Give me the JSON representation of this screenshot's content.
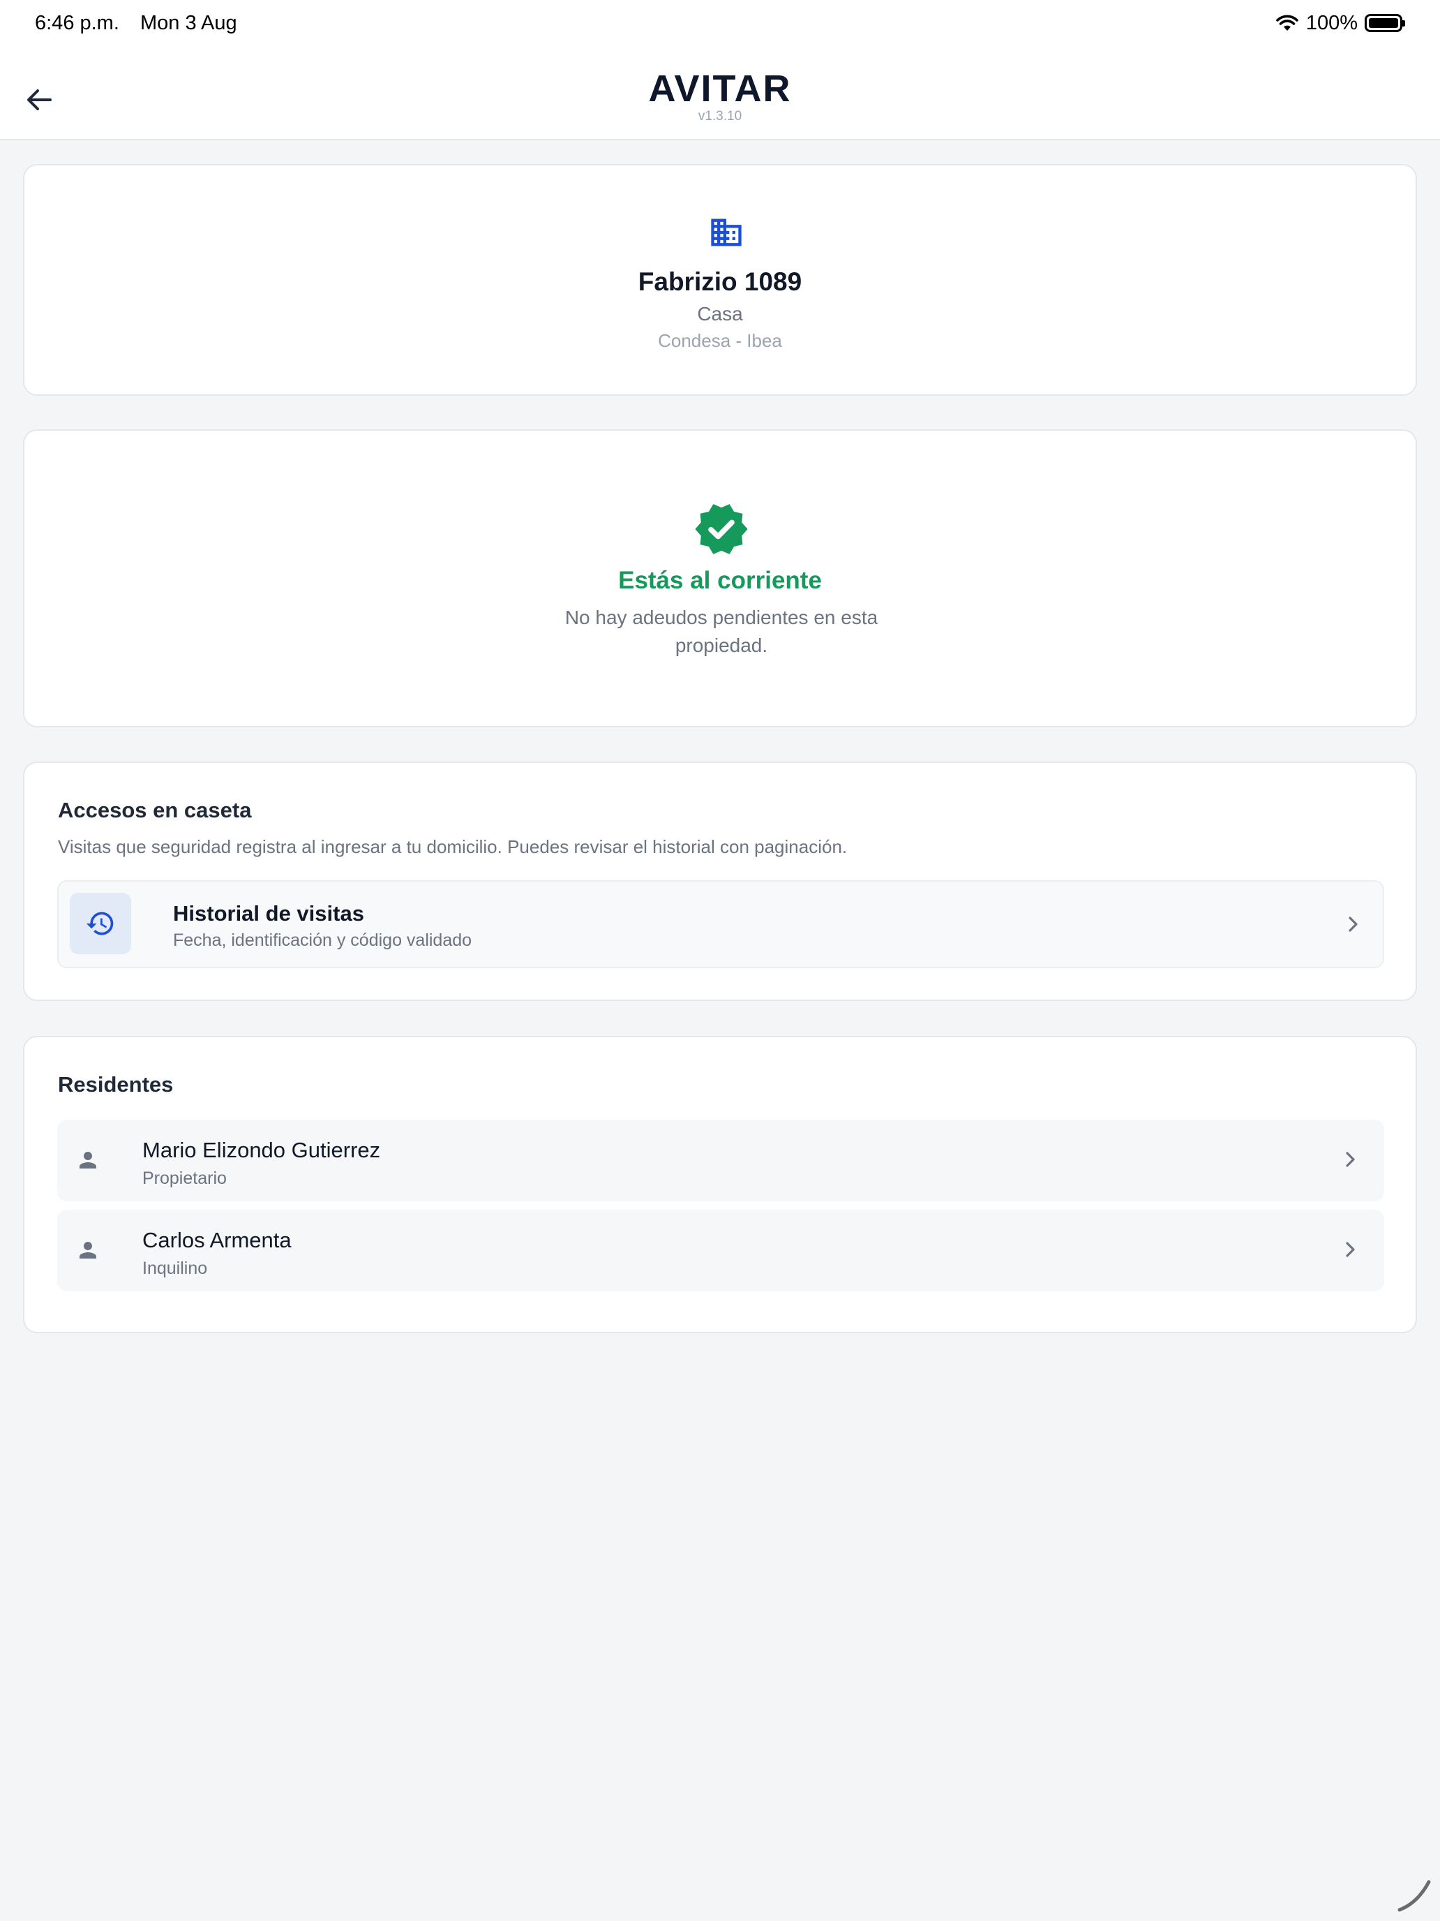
{
  "status_bar": {
    "time": "6:46 p.m.",
    "date": "Mon 3 Aug",
    "battery": "100%"
  },
  "header": {
    "logo": "AVITAR",
    "version": "v1.3.10"
  },
  "property": {
    "name": "Fabrizio 1089",
    "type": "Casa",
    "location": "Condesa - Ibea",
    "icon": "building-icon",
    "icon_color": "#1d4ed8"
  },
  "payment_status": {
    "title": "Estás al corriente",
    "description": "No hay adeudos pendientes en esta propiedad.",
    "icon": "verified-badge-icon",
    "color": "#169a5c"
  },
  "access": {
    "title": "Accesos en caseta",
    "description": "Visitas que seguridad registra al ingresar a tu domicilio. Puedes revisar el historial con paginación.",
    "history": {
      "title": "Historial de visitas",
      "subtitle": "Fecha, identificación y código validado",
      "icon": "history-icon"
    }
  },
  "residents": {
    "title": "Residentes",
    "items": [
      {
        "name": "Mario Elizondo Gutierrez",
        "role": "Propietario"
      },
      {
        "name": "Carlos Armenta",
        "role": "Inquilino"
      }
    ]
  }
}
